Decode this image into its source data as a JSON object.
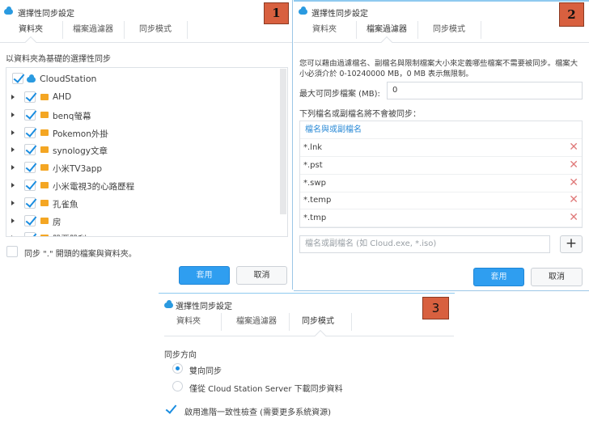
{
  "dialog_title": "選擇性同步設定",
  "tabs": [
    "資料夾",
    "檔案過濾器",
    "同步模式"
  ],
  "badges": [
    "1",
    "2",
    "3"
  ],
  "folders_panel": {
    "subtitle": "以資料夾為基礎的選擇性同步",
    "root": {
      "label": "CloudStation",
      "checked": true
    },
    "items": [
      {
        "label": "AHD",
        "checked": true
      },
      {
        "label": "benq螢幕",
        "checked": true
      },
      {
        "label": "Pokemon外掛",
        "checked": true
      },
      {
        "label": "synology文章",
        "checked": true
      },
      {
        "label": "小米TV3app",
        "checked": true
      },
      {
        "label": "小米電視3的心路歷程",
        "checked": true
      },
      {
        "label": "孔雀魚",
        "checked": true
      },
      {
        "label": "房",
        "checked": true
      },
      {
        "label": "股票股利",
        "checked": true
      }
    ],
    "dot_files_label": "同步 \".\" 開頭的檔案與資料夾。",
    "dot_files_checked": false
  },
  "filter_panel": {
    "description_line1": "您可以藉由過濾檔名、副檔名與限制檔案大小來定義哪些檔案不需要被同步。檔案大",
    "description_line2": "小必須介於 0-10240000 MB，0 MB 表示無限制。",
    "max_size_label": "最大可同步檔案 (MB):",
    "max_size_value": "0",
    "exclude_label": "下列檔名或副檔名將不會被同步：",
    "table_header": "檔名與或副檔名",
    "patterns": [
      "*.lnk",
      "*.pst",
      "*.swp",
      "*.temp",
      "*.tmp"
    ],
    "add_placeholder": "檔名或副檔名 (如 Cloud.exe, *.iso)",
    "add_button": "+"
  },
  "mode_panel": {
    "direction_label": "同步方向",
    "options": [
      {
        "label": "雙向同步",
        "selected": true
      },
      {
        "label": "僅從 Cloud Station Server 下載同步資料",
        "selected": false
      }
    ],
    "advanced_check_label": "啟用進階一致性檢查 (需要更多系統資源)",
    "advanced_check_checked": true
  },
  "buttons": {
    "apply": "套用",
    "cancel": "取消"
  },
  "colors": {
    "accent": "#2f9ef0",
    "folder": "#f4a623",
    "badge": "#d8603f",
    "delete": "#e07a7a"
  }
}
